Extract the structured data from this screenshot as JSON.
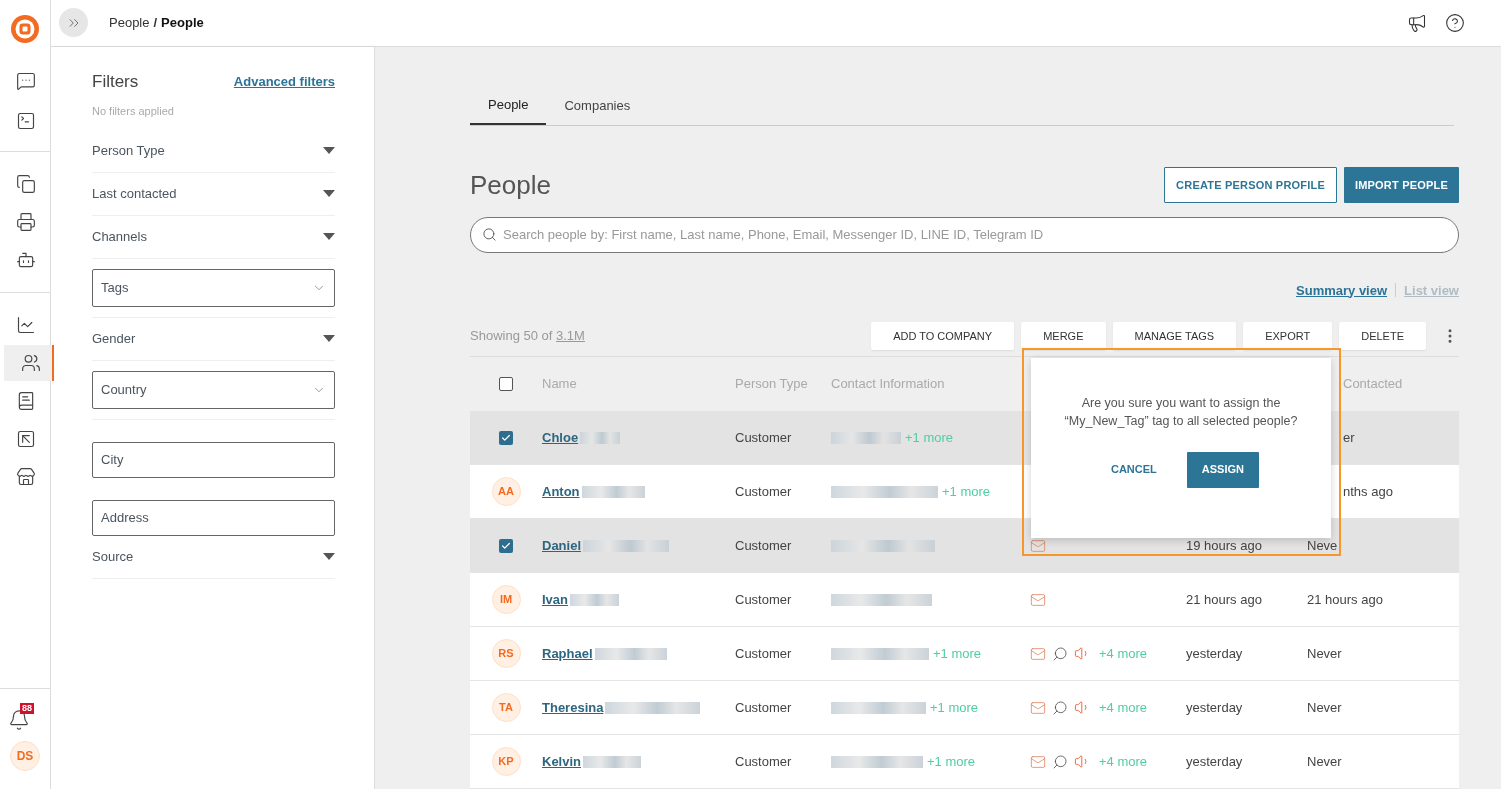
{
  "breadcrumb": {
    "parent": "People",
    "separator": "/",
    "current": "People"
  },
  "filters": {
    "title": "Filters",
    "advanced_link": "Advanced filters",
    "status": "No filters applied",
    "items": [
      {
        "kind": "collapsible",
        "label": "Person Type"
      },
      {
        "kind": "collapsible",
        "label": "Last contacted"
      },
      {
        "kind": "collapsible",
        "label": "Channels"
      },
      {
        "kind": "select",
        "placeholder": "Tags"
      },
      {
        "kind": "collapsible",
        "label": "Gender"
      },
      {
        "kind": "select",
        "placeholder": "Country"
      },
      {
        "kind": "input",
        "placeholder": "City"
      },
      {
        "kind": "input",
        "placeholder": "Address"
      },
      {
        "kind": "collapsible",
        "label": "Source"
      }
    ]
  },
  "notifications_badge": "88",
  "user_initials": "DS",
  "tabs": [
    {
      "label": "People",
      "selected": true
    },
    {
      "label": "Companies",
      "selected": false
    }
  ],
  "page_title": "People",
  "header_buttons": [
    {
      "label": "CREATE PERSON PROFILE",
      "kind": "outline"
    },
    {
      "label": "IMPORT PEOPLE",
      "kind": "primary"
    }
  ],
  "search": {
    "placeholder": "Search people by: First name, Last name, Phone, Email, Messenger ID, LINE ID, Telegram ID"
  },
  "views": [
    {
      "label": "Summary view",
      "selected": true
    },
    {
      "label": "List view",
      "selected": false
    }
  ],
  "showing": {
    "text": "Showing 50 of",
    "count": "3.1M"
  },
  "actions": [
    "ADD TO COMPANY",
    "MERGE",
    "MANAGE TAGS",
    "EXPORT",
    "DELETE"
  ],
  "table": {
    "select_all_checked": false,
    "columns": [
      "Name",
      "Person Type",
      "Contact Information"
    ],
    "column_last_contacted": "Contacted",
    "rows": [
      {
        "selected": true,
        "name": "Chloe",
        "person_type": "Customer",
        "contact_more": "+1 more",
        "channels": [],
        "channels_more": "",
        "last_seen": "",
        "last_contacted": "er"
      },
      {
        "selected": false,
        "initials": "AA",
        "name": "Anton",
        "person_type": "Customer",
        "contact_more": "+1 more",
        "channels": [],
        "channels_more": "",
        "last_seen": "",
        "last_contacted": "nths ago"
      },
      {
        "selected": true,
        "name": "Daniel",
        "person_type": "Customer",
        "contact_more": "",
        "channels": [
          {
            "kind": "mail"
          }
        ],
        "channels_more": "",
        "last_seen": "19 hours ago",
        "last_contacted": "Neve"
      },
      {
        "selected": false,
        "initials": "IM",
        "name": "Ivan",
        "person_type": "Customer",
        "contact_more": "",
        "channels": [
          {
            "kind": "mail"
          }
        ],
        "channels_more": "",
        "last_seen": "21 hours ago",
        "last_contacted": "21 hours ago"
      },
      {
        "selected": false,
        "initials": "RS",
        "name": "Raphael",
        "person_type": "Customer",
        "contact_more": "+1 more",
        "channels": [
          {
            "kind": "mail"
          },
          {
            "kind": "chat"
          },
          {
            "kind": "voice"
          }
        ],
        "channels_more": "+4 more",
        "last_seen": "yesterday",
        "last_contacted": "Never"
      },
      {
        "selected": false,
        "initials": "TA",
        "name": "Theresina",
        "person_type": "Customer",
        "contact_more": "+1 more",
        "channels": [
          {
            "kind": "mail"
          },
          {
            "kind": "chat"
          },
          {
            "kind": "voice"
          }
        ],
        "channels_more": "+4 more",
        "last_seen": "yesterday",
        "last_contacted": "Never"
      },
      {
        "selected": false,
        "initials": "KP",
        "name": "Kelvin",
        "person_type": "Customer",
        "contact_more": "+1 more",
        "channels": [
          {
            "kind": "mail"
          },
          {
            "kind": "chat"
          },
          {
            "kind": "voice"
          }
        ],
        "channels_more": "+4 more",
        "last_seen": "yesterday",
        "last_contacted": "Never"
      }
    ]
  },
  "dialog": {
    "message": "Are you sure you want to assign the “My_New_Tag” tag to all selected people?",
    "cancel": "CANCEL",
    "confirm": "ASSIGN"
  }
}
